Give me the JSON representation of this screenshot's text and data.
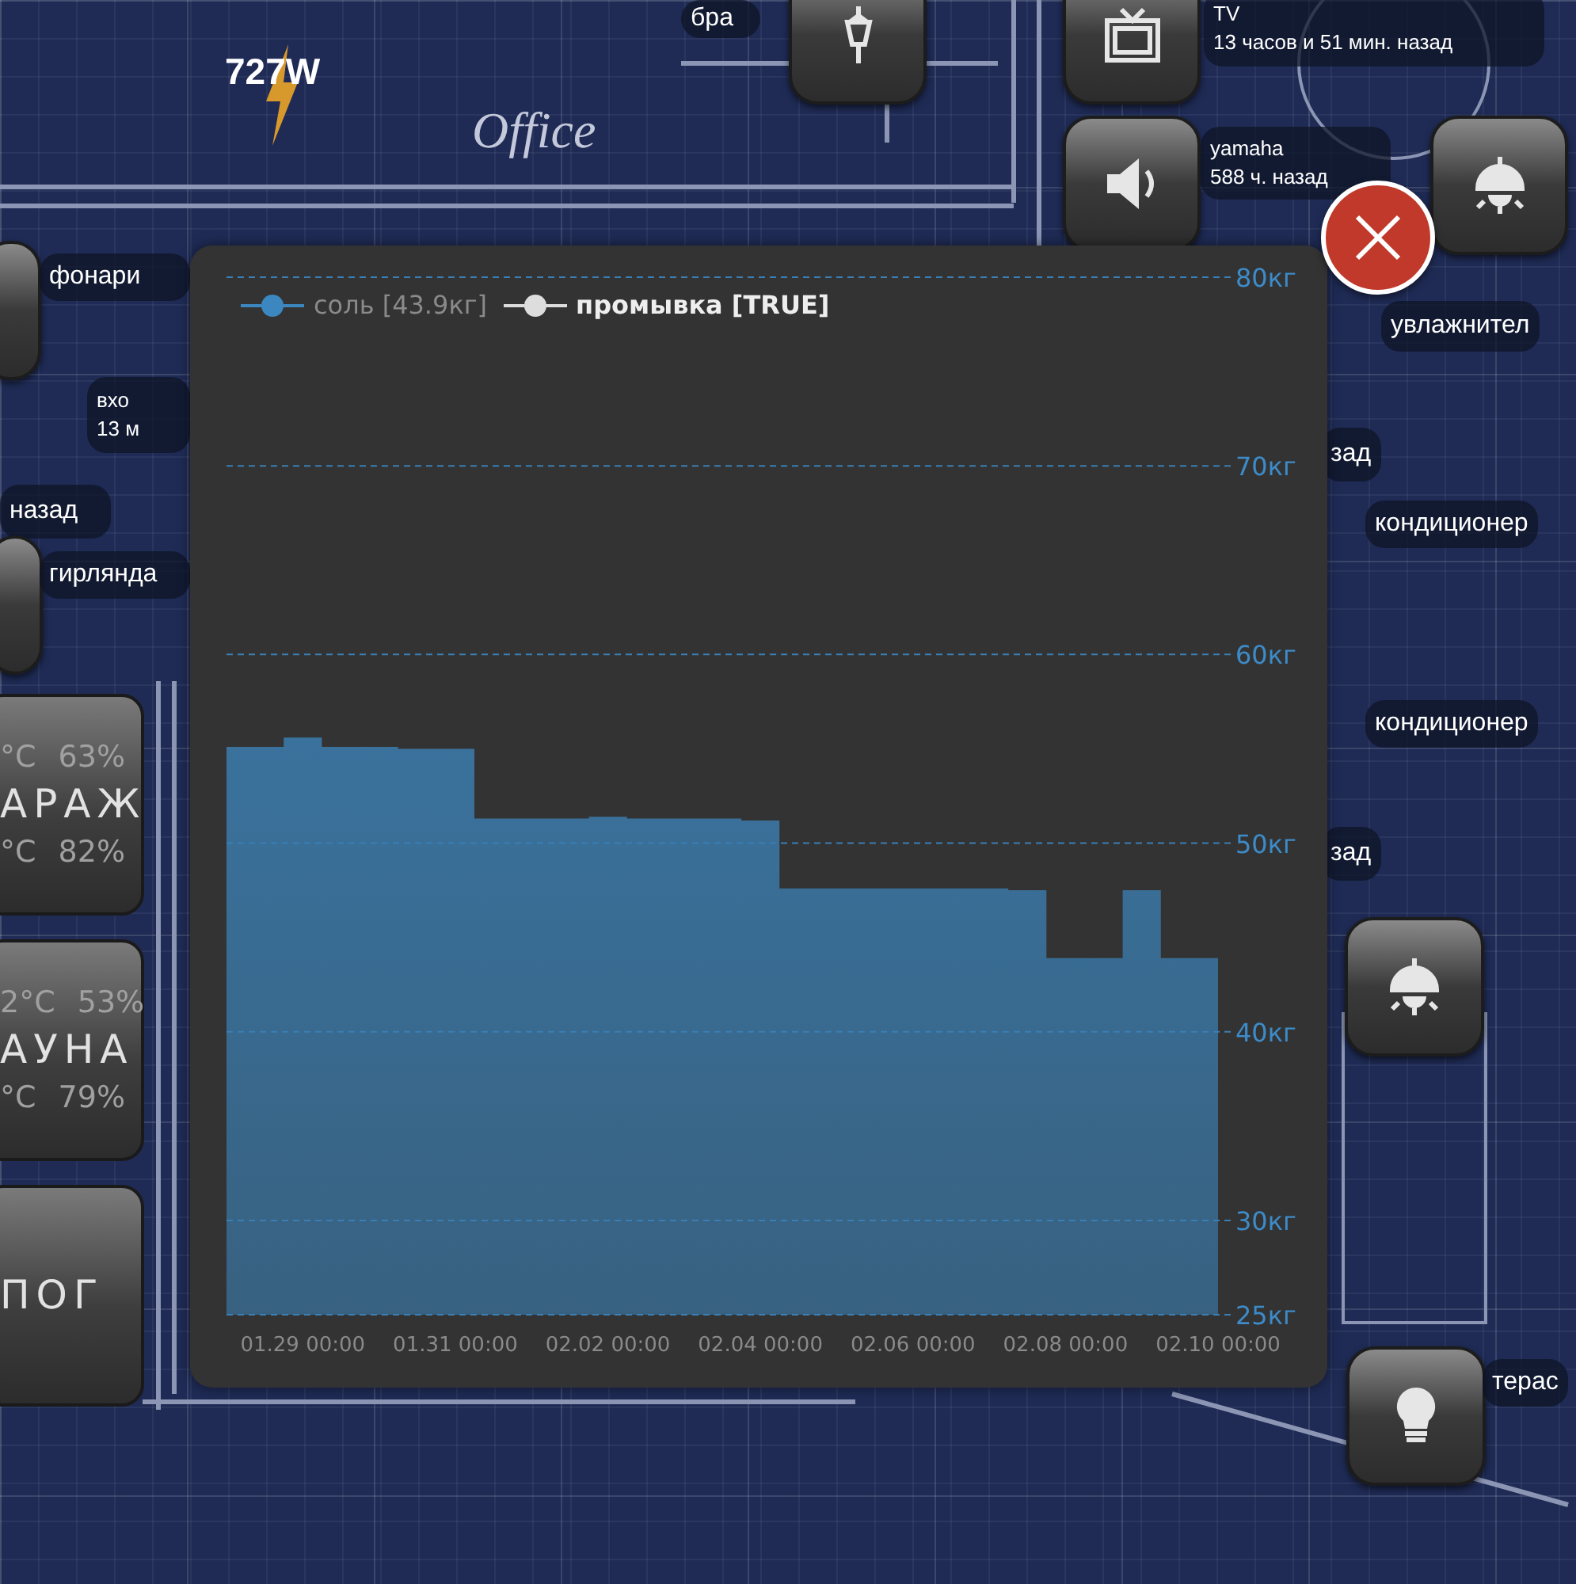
{
  "power": {
    "value": "727W"
  },
  "room_label": "Office",
  "devices": [
    {
      "kind": "label",
      "lines": [
        "бра"
      ]
    },
    {
      "kind": "button"
    },
    {
      "kind": "button"
    },
    {
      "kind": "label",
      "lines": [
        "TV",
        "13 часов и 51 мин. назад"
      ]
    },
    {
      "kind": "button"
    },
    {
      "kind": "label",
      "lines": [
        "yamaha",
        "588 ч. назад"
      ]
    },
    {
      "kind": "button"
    },
    {
      "kind": "label",
      "lines": [
        "увлажнител"
      ]
    },
    {
      "kind": "label",
      "lines": [
        "зад"
      ]
    },
    {
      "kind": "label",
      "lines": [
        "кондиционер"
      ]
    },
    {
      "kind": "label",
      "lines": [
        "кондиционер"
      ]
    },
    {
      "kind": "label",
      "lines": [
        "зад"
      ]
    },
    {
      "kind": "button"
    },
    {
      "kind": "button"
    },
    {
      "kind": "label",
      "lines": [
        "терас"
      ]
    },
    {
      "kind": "button"
    },
    {
      "kind": "label",
      "lines": [
        "фонари"
      ]
    },
    {
      "kind": "label",
      "lines": [
        "вхо",
        "13 м"
      ]
    },
    {
      "kind": "label",
      "lines": [
        "назад"
      ]
    },
    {
      "kind": "button"
    },
    {
      "kind": "label",
      "lines": [
        "гирлянда"
      ]
    },
    {
      "kind": "room",
      "name": "АРАЖ",
      "readings": [
        {
          "temperature": "°C",
          "humidity": "63%"
        },
        {
          "temperature": "°C",
          "humidity": "82%"
        }
      ]
    },
    {
      "kind": "room",
      "name": "АУНА",
      "readings": [
        {
          "temperature": "2°C",
          "humidity": "53%"
        },
        {
          "temperature": "°C",
          "humidity": "79%"
        }
      ]
    },
    {
      "kind": "room",
      "name": "ПОГ"
    }
  ],
  "dialog": {
    "legend": [
      {
        "selected": false
      },
      {
        "selected": true
      }
    ],
    "chart_data": {
      "type": "area",
      "grid": true,
      "ylim": [
        25,
        80
      ],
      "categories": [
        null,
        null,
        "01.29 00:00",
        null,
        null,
        null,
        "01.31 00:00",
        null,
        null,
        null,
        "02.02 00:00",
        null,
        null,
        null,
        "02.04 00:00",
        null,
        null,
        null,
        "02.06 00:00",
        null,
        null,
        null,
        "02.08 00:00",
        null,
        null,
        null,
        "02.10 00:00"
      ],
      "yticks": [
        {
          "value": 25,
          "label": "25кг"
        },
        {
          "value": 30,
          "label": "30кг"
        },
        {
          "value": 40,
          "label": "40кг"
        },
        {
          "value": 50,
          "label": "50кг"
        },
        {
          "value": 60,
          "label": "60кг"
        },
        {
          "value": 70,
          "label": "70кг"
        },
        {
          "value": 80,
          "label": "80кг"
        }
      ],
      "series": [
        {
          "name": "соль [43.9кг]",
          "color": "#3c87c0",
          "values": [
            55.1,
            55.1,
            55.6,
            55.1,
            55.1,
            55.0,
            55.0,
            51.3,
            51.3,
            51.3,
            51.4,
            51.3,
            51.3,
            51.3,
            51.2,
            47.6,
            47.6,
            47.6,
            47.6,
            47.6,
            47.6,
            47.5,
            43.9,
            43.9,
            47.5,
            43.9,
            43.9
          ]
        },
        {
          "name": "промывка [TRUE]",
          "color": "#dddddd",
          "values": [
            null,
            null,
            null,
            null,
            null,
            null,
            null,
            null,
            null,
            null,
            null,
            null,
            null,
            null,
            null,
            null,
            null,
            null,
            null,
            null,
            null,
            null,
            null,
            null,
            null,
            null,
            null
          ]
        }
      ]
    }
  }
}
